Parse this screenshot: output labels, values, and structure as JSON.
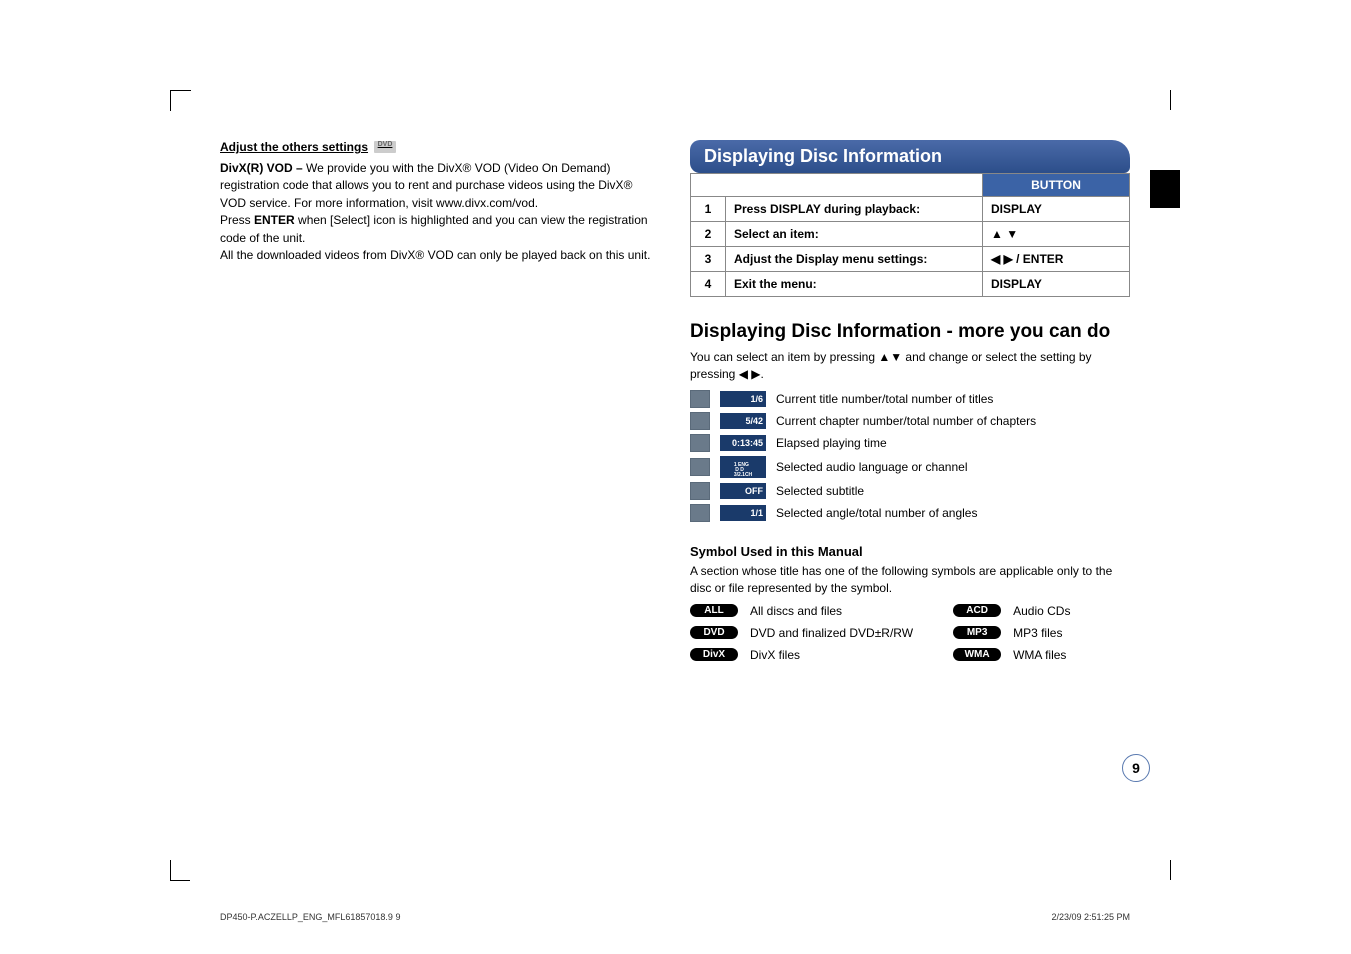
{
  "left": {
    "heading": "Adjust the others settings",
    "heading_icon": "DVD",
    "p1_prefix": "DivX(R) VOD – ",
    "p1": "We provide you with the DivX® VOD (Video On Demand) registration code that allows you to rent and purchase videos using the DivX® VOD service. For more information, visit www.divx.com/vod.",
    "p2_prefix": "Press ",
    "p2_bold": "ENTER",
    "p2_suffix": " when [Select] icon is highlighted and you can view the registration code of the unit.",
    "p3": "All the downloaded videos from DivX® VOD can only be played back on this unit."
  },
  "right": {
    "panel_title": "Displaying Disc Information",
    "button_header": "BUTTON",
    "steps": [
      {
        "n": "1",
        "desc": "Press DISPLAY during playback:",
        "btn": "DISPLAY"
      },
      {
        "n": "2",
        "desc": "Select an item:",
        "btn": "▲ ▼"
      },
      {
        "n": "3",
        "desc": "Adjust the Display menu settings:",
        "btn": "◀ ▶ / ENTER"
      },
      {
        "n": "4",
        "desc": "Exit the menu:",
        "btn": "DISPLAY"
      }
    ],
    "more_heading": "Displaying Disc Information - more you can do",
    "more_intro": "You can select an item by pressing ▲▼ and change or select the setting by pressing ◀ ▶.",
    "osd": [
      {
        "badge": "1/6",
        "text": "Current title number/total number of titles"
      },
      {
        "badge": "5/42",
        "text": "Current chapter number/total number of chapters"
      },
      {
        "badge": "0:13:45",
        "text": "Elapsed playing time"
      },
      {
        "badge": "1 ENG\n D D\n3/2.1CH",
        "text": "Selected audio language or channel"
      },
      {
        "badge": "OFF",
        "text": "Selected subtitle"
      },
      {
        "badge": "1/1",
        "text": "Selected angle/total number of angles"
      }
    ],
    "symbol_heading": "Symbol Used in this Manual",
    "symbol_intro": "A section whose title has one of the following symbols are applicable only to the disc or file represented by the symbol.",
    "symbols_left": [
      {
        "tag": "ALL",
        "text": "All discs and files"
      },
      {
        "tag": "DVD",
        "text": "DVD and finalized DVD±R/RW"
      },
      {
        "tag": "DivX",
        "text": "DivX files"
      }
    ],
    "symbols_right": [
      {
        "tag": "ACD",
        "text": "Audio CDs"
      },
      {
        "tag": "MP3",
        "text": "MP3 files"
      },
      {
        "tag": "WMA",
        "text": "WMA files"
      }
    ]
  },
  "page_number": "9",
  "footer_left": "DP450-P.ACZELLP_ENG_MFL61857018.9   9",
  "footer_right": "2/23/09   2:51:25 PM"
}
